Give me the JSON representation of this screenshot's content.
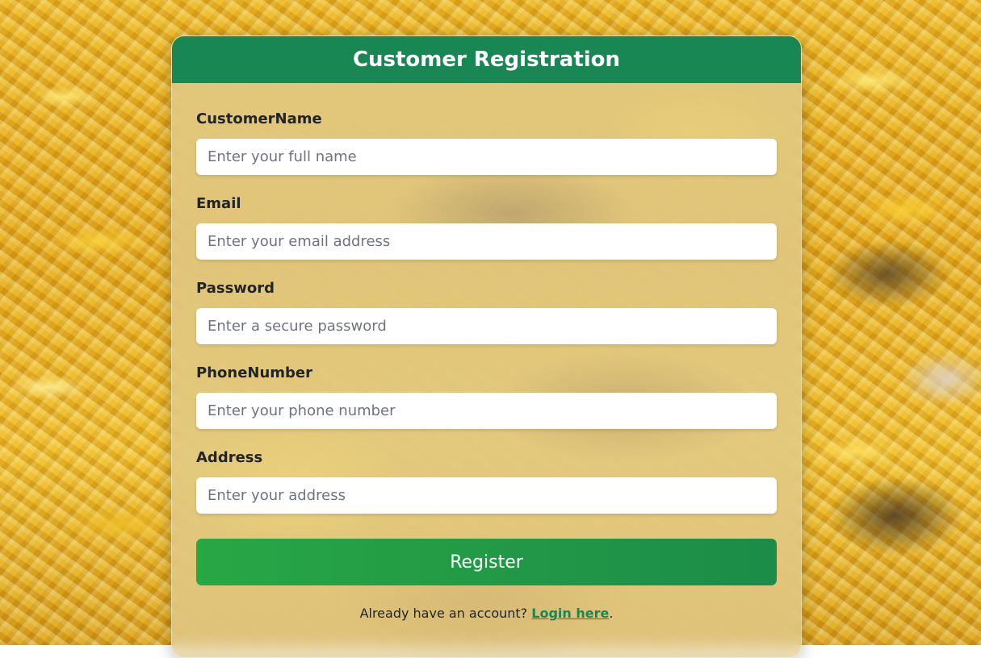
{
  "page": {
    "title": "Customer Registration"
  },
  "form": {
    "fields": [
      {
        "label": "CustomerName",
        "placeholder": "Enter your full name",
        "value": ""
      },
      {
        "label": "Email",
        "placeholder": "Enter your email address",
        "value": ""
      },
      {
        "label": "Password",
        "placeholder": "Enter a secure password",
        "value": ""
      },
      {
        "label": "PhoneNumber",
        "placeholder": "Enter your phone number",
        "value": ""
      },
      {
        "label": "Address",
        "placeholder": "Enter your address",
        "value": ""
      }
    ],
    "submit_label": "Register"
  },
  "footer": {
    "prompt_text": "Already have an account?",
    "login_link_text": "Login here",
    "trailing_text": "."
  },
  "colors": {
    "header_bg": "#198754",
    "button_bg": "#28a745",
    "link": "#198754"
  }
}
